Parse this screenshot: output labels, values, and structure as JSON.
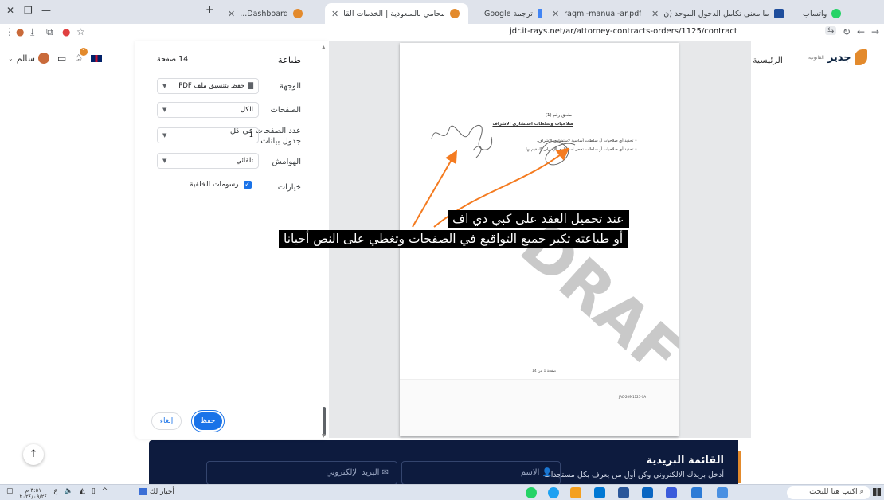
{
  "browser": {
    "tabs": [
      {
        "title": "واتساب",
        "color": "#25d366"
      },
      {
        "title": "ما معنى تكامل الدخول الموحد (ن",
        "color": "#1f4e9c"
      },
      {
        "title": "raqmi-manual-ar.pdf",
        "color": "#888888"
      },
      {
        "title": "ترجمة Google",
        "color": "#4285f4"
      },
      {
        "title": "محامي بالسعودية | الخدمات القا",
        "color": "#e38a2c"
      },
      {
        "title": "Dashboard...",
        "color": "#e38a2c"
      }
    ],
    "url": "jdr.it-rays.net/ar/attorney-contracts-orders/1125/contract"
  },
  "site": {
    "logo_text": "جدير",
    "logo_sub": "القانونية",
    "nav_home": "الرئيسية",
    "user_name": "سالم",
    "notification_count": "1",
    "newsletter_title": "القائمة البريدية",
    "newsletter_sub": "أدخل بريدك الالكتروني وكن أول من يعرف بكل مستجدات",
    "name_placeholder": "الاسم",
    "email_placeholder": "البريد الإلكتروني"
  },
  "print": {
    "title": "طباعة",
    "page_count": "14 صفحة",
    "destination_label": "الوجهة",
    "destination_value": "حفظ بتنسيق ملف PDF",
    "pages_label": "الصفحات",
    "pages_value": "الكل",
    "pages_per_sheet_label": "عدد الصفحات في كل جدول بيانات",
    "pages_per_sheet_value": "1",
    "margins_label": "الهوامش",
    "margins_value": "تلقائي",
    "options_label": "خيارات",
    "background_graphics_label": "رسومات الخلفية",
    "save_label": "حفظ",
    "cancel_label": "إلغاء"
  },
  "preview": {
    "annex_title": "ملحق رقم (1)",
    "annex_subtitle": "صلاحيات وسلطات استشاري الإشراف",
    "bullet1": "تحديد أي صلاحيات أو سلطات أساسية لاستشاري الإشراف.",
    "bullet2": "تحديد أي صلاحيات أو سلطات تخص استشاري الإشراف المقيم بها.",
    "page_number": "صفحة 1 من 14",
    "ref": "JAC-209-1125-SA",
    "watermark": "DRAFT"
  },
  "annotation": {
    "line1": "عند تحميل العقد على كبي دي اف",
    "line2": "أو طباعته تكبر جميع التواقيع في الصفحات وتغطي على النص أحيانا",
    "color": "#f47b20"
  },
  "taskbar": {
    "search_placeholder": "اكتب هنا للبحث",
    "news_label": "أخبار لك",
    "time": "٣:٥١ م",
    "date": "٢٠٢٤/٠٩/٢٤"
  }
}
